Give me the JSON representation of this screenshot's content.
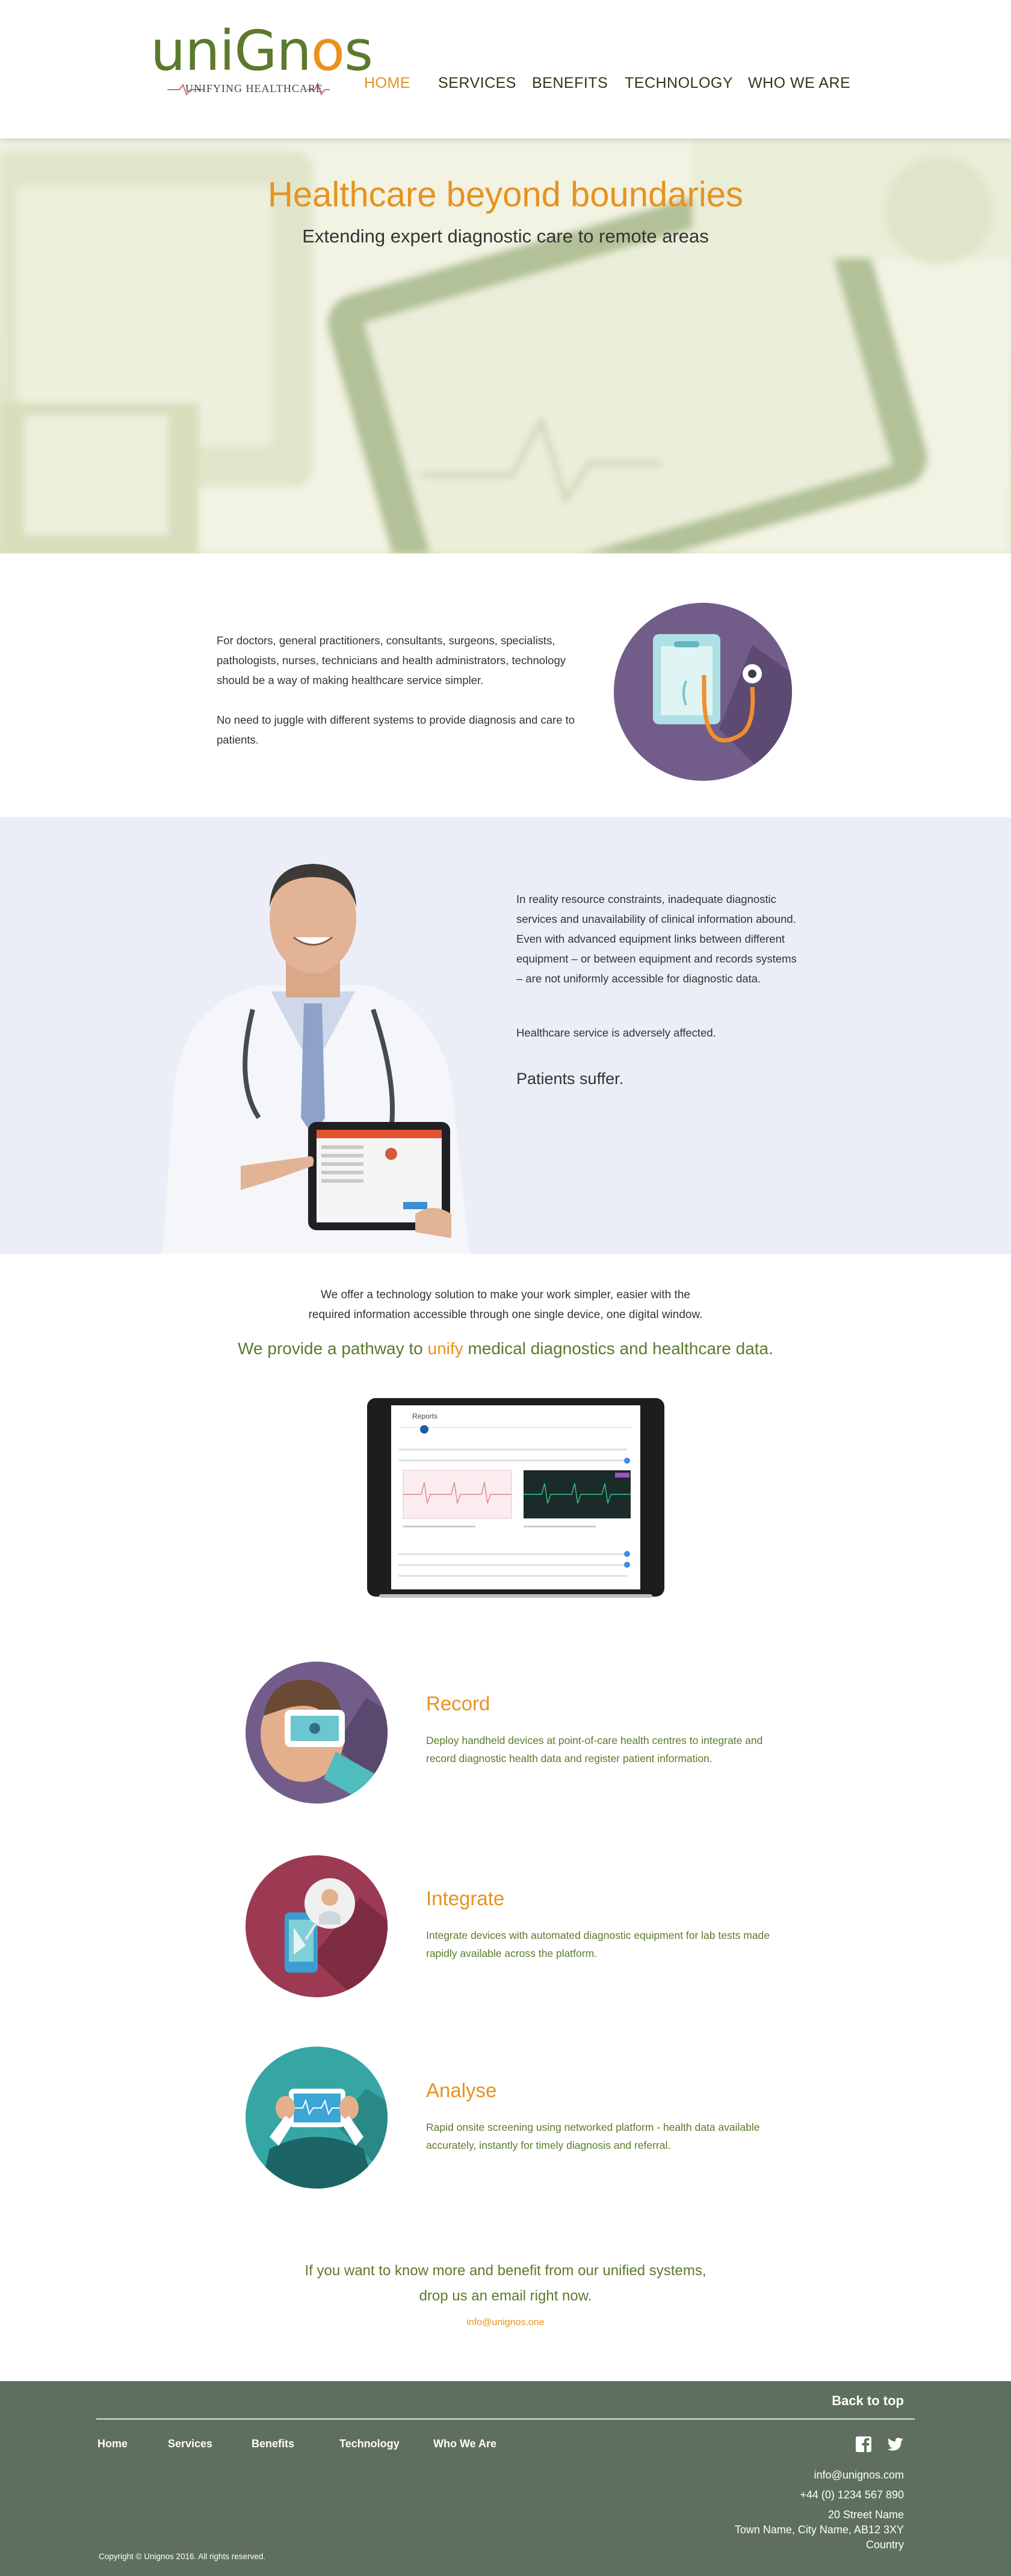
{
  "header": {
    "logo_text_a": "uni",
    "logo_text_b": "G",
    "logo_text_c": "n",
    "logo_text_d": "o",
    "logo_text_e": "s",
    "logo_tagline": "UNIFYING HEALTHCARE",
    "nav": [
      "HOME",
      "SERVICES",
      "BENEFITS",
      "TECHNOLOGY",
      "WHO WE ARE"
    ]
  },
  "hero": {
    "title": "Healthcare beyond boundaries",
    "subtitle": "Extending expert diagnostic care to remote areas"
  },
  "intro": {
    "paragraph1": "For doctors, general practitioners, consultants, surgeons, specialists, pathologists, nurses, technicians and health administrators, technology should be a way of making healthcare service simpler.",
    "paragraph2": "No need to juggle with different systems to provide diagnosis and care to patients."
  },
  "problem": {
    "paragraph1": "In reality resource constraints, inadequate diagnostic services and unavailability of clinical information abound. Even with advanced equipment links between different equipment – or between equipment and records systems – are not uniformly accessible for diagnostic data.",
    "paragraph2": "Healthcare service is adversely affected.",
    "paragraph3": "Patients suffer."
  },
  "solution": {
    "line1": "We offer a technology solution to make your work simpler, easier with the",
    "line2": "required information accessible through one single device, one digital window.",
    "pathway_before": "We provide a pathway to ",
    "pathway_highlight": "unify",
    "pathway_after": " medical diagnostics and healthcare data.",
    "tablet_title": "Reports"
  },
  "features": [
    {
      "title": "Record",
      "description": "Deploy handheld devices at point-of-care health centres to integrate and record diagnostic health data and register patient information.",
      "icon": "record-icon",
      "color": "#725d8a"
    },
    {
      "title": "Integrate",
      "description": "Integrate devices with automated diagnostic equipment for lab tests made rapidly available across the platform.",
      "icon": "integrate-icon",
      "color": "#9b3a52"
    },
    {
      "title": "Analyse",
      "description": "Rapid onsite screening using networked platform -  health data available accurately, instantly for timely diagnosis and referral.",
      "icon": "analyse-icon",
      "color": "#35a6a4"
    }
  ],
  "cta": {
    "line1": "If you want to know more and benefit from our unified systems,",
    "line2": "drop us an email right now.",
    "email": "info@unignos.one"
  },
  "footer": {
    "back_to_top": "Back to top",
    "nav": [
      "Home",
      "Services",
      "Benefits",
      "Technology",
      "Who We Are"
    ],
    "email": "info@unignos.com",
    "phone": "+44 (0) 1234 567 890",
    "address1": "20 Street Name",
    "address2": "Town Name, City Name, AB12 3XY",
    "address3": "Country",
    "copyright": "Copyright © Unignos 2016. All rights reserved.",
    "social": [
      "facebook-icon",
      "twitter-icon"
    ]
  },
  "colors": {
    "brand_green": "#5b7a2c",
    "accent_orange": "#e8921e",
    "footer_bg": "#5e6f5f",
    "problem_bg": "#eceef7"
  }
}
